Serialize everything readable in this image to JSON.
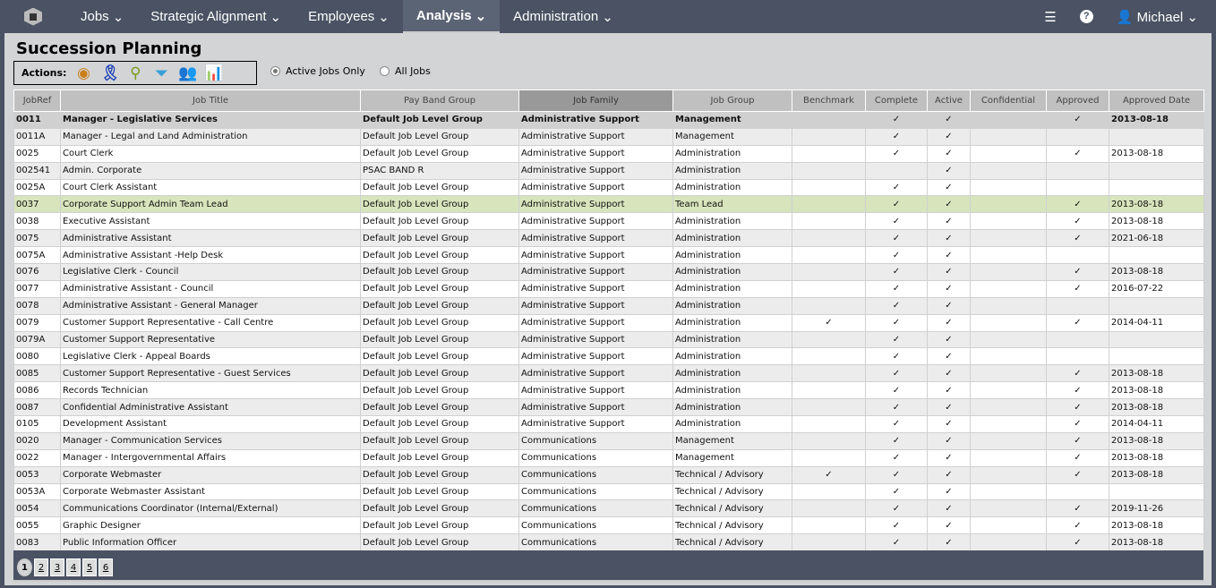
{
  "nav": {
    "items": [
      "Jobs",
      "Strategic Alignment",
      "Employees",
      "Analysis",
      "Administration"
    ],
    "active": "Analysis",
    "user": "Michael"
  },
  "page": {
    "title": "Succession Planning",
    "actions_label": "Actions:",
    "radio_active": "Active Jobs Only",
    "radio_all": "All Jobs",
    "selected_filter": "Active Jobs Only"
  },
  "icons": [
    "view-eye-icon",
    "award-ribbon-icon",
    "magnifier-icon",
    "filter-funnel-icon",
    "people-group-icon",
    "report-chart-icon"
  ],
  "table": {
    "columns": [
      "JobRef",
      "Job Title",
      "Pay Band Group",
      "Job Family",
      "Job Group",
      "Benchmark",
      "Complete",
      "Active",
      "Confidential",
      "Approved",
      "Approved Date"
    ],
    "sorted_column": "Job Family",
    "rows": [
      [
        "0011",
        "Manager - Legislative Services",
        "Default Job Level Group",
        "Administrative Support",
        "Management",
        "",
        "✓",
        "✓",
        "",
        "✓",
        "2013-08-18"
      ],
      [
        "0011A",
        "Manager - Legal and Land Administration",
        "Default Job Level Group",
        "Administrative Support",
        "Management",
        "",
        "✓",
        "✓",
        "",
        "",
        ""
      ],
      [
        "0025",
        "Court Clerk",
        "Default Job Level Group",
        "Administrative Support",
        "Administration",
        "",
        "✓",
        "✓",
        "",
        "✓",
        "2013-08-18"
      ],
      [
        "002541",
        "Admin. Corporate",
        "PSAC BAND R",
        "Administrative Support",
        "Administration",
        "",
        "",
        "✓",
        "",
        "",
        ""
      ],
      [
        "0025A",
        "Court Clerk Assistant",
        "Default Job Level Group",
        "Administrative Support",
        "Administration",
        "",
        "✓",
        "✓",
        "",
        "",
        ""
      ],
      [
        "0037",
        "Corporate Support Admin Team Lead",
        "Default Job Level Group",
        "Administrative Support",
        "Team Lead",
        "",
        "✓",
        "✓",
        "",
        "✓",
        "2013-08-18"
      ],
      [
        "0038",
        "Executive Assistant",
        "Default Job Level Group",
        "Administrative Support",
        "Administration",
        "",
        "✓",
        "✓",
        "",
        "✓",
        "2013-08-18"
      ],
      [
        "0075",
        "Administrative Assistant",
        "Default Job Level Group",
        "Administrative Support",
        "Administration",
        "",
        "✓",
        "✓",
        "",
        "✓",
        "2021-06-18"
      ],
      [
        "0075A",
        "Administrative Assistant -Help Desk",
        "Default Job Level Group",
        "Administrative Support",
        "Administration",
        "",
        "✓",
        "✓",
        "",
        "",
        ""
      ],
      [
        "0076",
        "Legislative Clerk - Council",
        "Default Job Level Group",
        "Administrative Support",
        "Administration",
        "",
        "✓",
        "✓",
        "",
        "✓",
        "2013-08-18"
      ],
      [
        "0077",
        "Administrative Assistant - Council",
        "Default Job Level Group",
        "Administrative Support",
        "Administration",
        "",
        "✓",
        "✓",
        "",
        "✓",
        "2016-07-22"
      ],
      [
        "0078",
        "Administrative Assistant - General Manager",
        "Default Job Level Group",
        "Administrative Support",
        "Administration",
        "",
        "✓",
        "✓",
        "",
        "",
        ""
      ],
      [
        "0079",
        "Customer Support Representative - Call Centre",
        "Default Job Level Group",
        "Administrative Support",
        "Administration",
        "✓",
        "✓",
        "✓",
        "",
        "✓",
        "2014-04-11"
      ],
      [
        "0079A",
        "Customer Support Representative",
        "Default Job Level Group",
        "Administrative Support",
        "Administration",
        "",
        "✓",
        "✓",
        "",
        "",
        ""
      ],
      [
        "0080",
        "Legislative Clerk - Appeal Boards",
        "Default Job Level Group",
        "Administrative Support",
        "Administration",
        "",
        "✓",
        "✓",
        "",
        "",
        ""
      ],
      [
        "0085",
        "Customer Support Representative - Guest Services",
        "Default Job Level Group",
        "Administrative Support",
        "Administration",
        "",
        "✓",
        "✓",
        "",
        "✓",
        "2013-08-18"
      ],
      [
        "0086",
        "Records Technician",
        "Default Job Level Group",
        "Administrative Support",
        "Administration",
        "",
        "✓",
        "✓",
        "",
        "✓",
        "2013-08-18"
      ],
      [
        "0087",
        "Confidential Administrative Assistant",
        "Default Job Level Group",
        "Administrative Support",
        "Administration",
        "",
        "✓",
        "✓",
        "",
        "✓",
        "2013-08-18"
      ],
      [
        "0105",
        "Development Assistant",
        "Default Job Level Group",
        "Administrative Support",
        "Administration",
        "",
        "✓",
        "✓",
        "",
        "✓",
        "2014-04-11"
      ],
      [
        "0020",
        "Manager - Communication Services",
        "Default Job Level Group",
        "Communications",
        "Management",
        "",
        "✓",
        "✓",
        "",
        "✓",
        "2013-08-18"
      ],
      [
        "0022",
        "Manager - Intergovernmental Affairs",
        "Default Job Level Group",
        "Communications",
        "Management",
        "",
        "✓",
        "✓",
        "",
        "✓",
        "2013-08-18"
      ],
      [
        "0053",
        "Corporate Webmaster",
        "Default Job Level Group",
        "Communications",
        "Technical / Advisory",
        "✓",
        "✓",
        "✓",
        "",
        "✓",
        "2013-08-18"
      ],
      [
        "0053A",
        "Corporate Webmaster Assistant",
        "Default Job Level Group",
        "Communications",
        "Technical / Advisory",
        "",
        "✓",
        "✓",
        "",
        "",
        ""
      ],
      [
        "0054",
        "Communications Coordinator (Internal/External)",
        "Default Job Level Group",
        "Communications",
        "Technical / Advisory",
        "",
        "✓",
        "✓",
        "",
        "✓",
        "2019-11-26"
      ],
      [
        "0055",
        "Graphic Designer",
        "Default Job Level Group",
        "Communications",
        "Technical / Advisory",
        "",
        "✓",
        "✓",
        "",
        "✓",
        "2013-08-18"
      ],
      [
        "0083",
        "Public Information Officer",
        "Default Job Level Group",
        "Communications",
        "Technical / Advisory",
        "",
        "✓",
        "✓",
        "",
        "✓",
        "2013-08-18"
      ]
    ],
    "highlighted_row": "0037"
  },
  "pager": {
    "pages": [
      "1",
      "2",
      "3",
      "4",
      "5",
      "6"
    ],
    "current": "1"
  }
}
